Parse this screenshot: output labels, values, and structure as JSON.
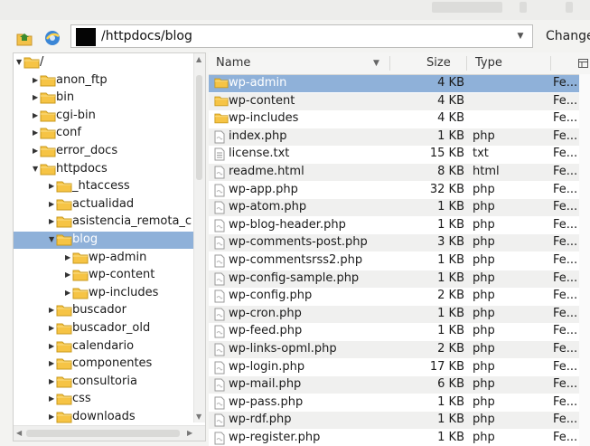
{
  "toolbar": {
    "path": "/httpdocs/blog",
    "change_label": "Change"
  },
  "tree": {
    "items": [
      {
        "label": "/",
        "depth": 0,
        "expanded": true
      },
      {
        "label": "anon_ftp",
        "depth": 1
      },
      {
        "label": "bin",
        "depth": 1
      },
      {
        "label": "cgi-bin",
        "depth": 1
      },
      {
        "label": "conf",
        "depth": 1
      },
      {
        "label": "error_docs",
        "depth": 1
      },
      {
        "label": "httpdocs",
        "depth": 1,
        "expanded": true
      },
      {
        "label": "_htaccess",
        "depth": 2
      },
      {
        "label": "actualidad",
        "depth": 2
      },
      {
        "label": "asistencia_remota_c",
        "depth": 2
      },
      {
        "label": "blog",
        "depth": 2,
        "expanded": true,
        "selected": true
      },
      {
        "label": "wp-admin",
        "depth": 3
      },
      {
        "label": "wp-content",
        "depth": 3
      },
      {
        "label": "wp-includes",
        "depth": 3
      },
      {
        "label": "buscador",
        "depth": 2
      },
      {
        "label": "buscador_old",
        "depth": 2
      },
      {
        "label": "calendario",
        "depth": 2
      },
      {
        "label": "componentes",
        "depth": 2
      },
      {
        "label": "consultoria",
        "depth": 2
      },
      {
        "label": "css",
        "depth": 2
      },
      {
        "label": "downloads",
        "depth": 2
      }
    ]
  },
  "files": {
    "columns": {
      "name": "Name",
      "size": "Size",
      "type": "Type"
    },
    "rows": [
      {
        "name": "wp-admin",
        "size": "4 KB",
        "type": "",
        "extra": "Fe...",
        "kind": "folder",
        "selected": true
      },
      {
        "name": "wp-content",
        "size": "4 KB",
        "type": "",
        "extra": "Fe...",
        "kind": "folder"
      },
      {
        "name": "wp-includes",
        "size": "4 KB",
        "type": "",
        "extra": "Fe...",
        "kind": "folder"
      },
      {
        "name": "index.php",
        "size": "1 KB",
        "type": "php",
        "extra": "Fe...",
        "kind": "file"
      },
      {
        "name": "license.txt",
        "size": "15 KB",
        "type": "txt",
        "extra": "Fe...",
        "kind": "text"
      },
      {
        "name": "readme.html",
        "size": "8 KB",
        "type": "html",
        "extra": "Fe...",
        "kind": "file"
      },
      {
        "name": "wp-app.php",
        "size": "32 KB",
        "type": "php",
        "extra": "Fe...",
        "kind": "file"
      },
      {
        "name": "wp-atom.php",
        "size": "1 KB",
        "type": "php",
        "extra": "Fe...",
        "kind": "file"
      },
      {
        "name": "wp-blog-header.php",
        "size": "1 KB",
        "type": "php",
        "extra": "Fe...",
        "kind": "file"
      },
      {
        "name": "wp-comments-post.php",
        "size": "3 KB",
        "type": "php",
        "extra": "Fe...",
        "kind": "file"
      },
      {
        "name": "wp-commentsrss2.php",
        "size": "1 KB",
        "type": "php",
        "extra": "Fe...",
        "kind": "file"
      },
      {
        "name": "wp-config-sample.php",
        "size": "1 KB",
        "type": "php",
        "extra": "Fe...",
        "kind": "file"
      },
      {
        "name": "wp-config.php",
        "size": "2 KB",
        "type": "php",
        "extra": "Fe...",
        "kind": "file"
      },
      {
        "name": "wp-cron.php",
        "size": "1 KB",
        "type": "php",
        "extra": "Fe...",
        "kind": "file"
      },
      {
        "name": "wp-feed.php",
        "size": "1 KB",
        "type": "php",
        "extra": "Fe...",
        "kind": "file"
      },
      {
        "name": "wp-links-opml.php",
        "size": "2 KB",
        "type": "php",
        "extra": "Fe...",
        "kind": "file"
      },
      {
        "name": "wp-login.php",
        "size": "17 KB",
        "type": "php",
        "extra": "Fe...",
        "kind": "file"
      },
      {
        "name": "wp-mail.php",
        "size": "6 KB",
        "type": "php",
        "extra": "Fe...",
        "kind": "file"
      },
      {
        "name": "wp-pass.php",
        "size": "1 KB",
        "type": "php",
        "extra": "Fe...",
        "kind": "file"
      },
      {
        "name": "wp-rdf.php",
        "size": "1 KB",
        "type": "php",
        "extra": "Fe...",
        "kind": "file"
      },
      {
        "name": "wp-register.php",
        "size": "1 KB",
        "type": "php",
        "extra": "Fe...",
        "kind": "file"
      }
    ]
  },
  "colors": {
    "selection": "#8fb1d9",
    "folder": "#f6c445"
  }
}
